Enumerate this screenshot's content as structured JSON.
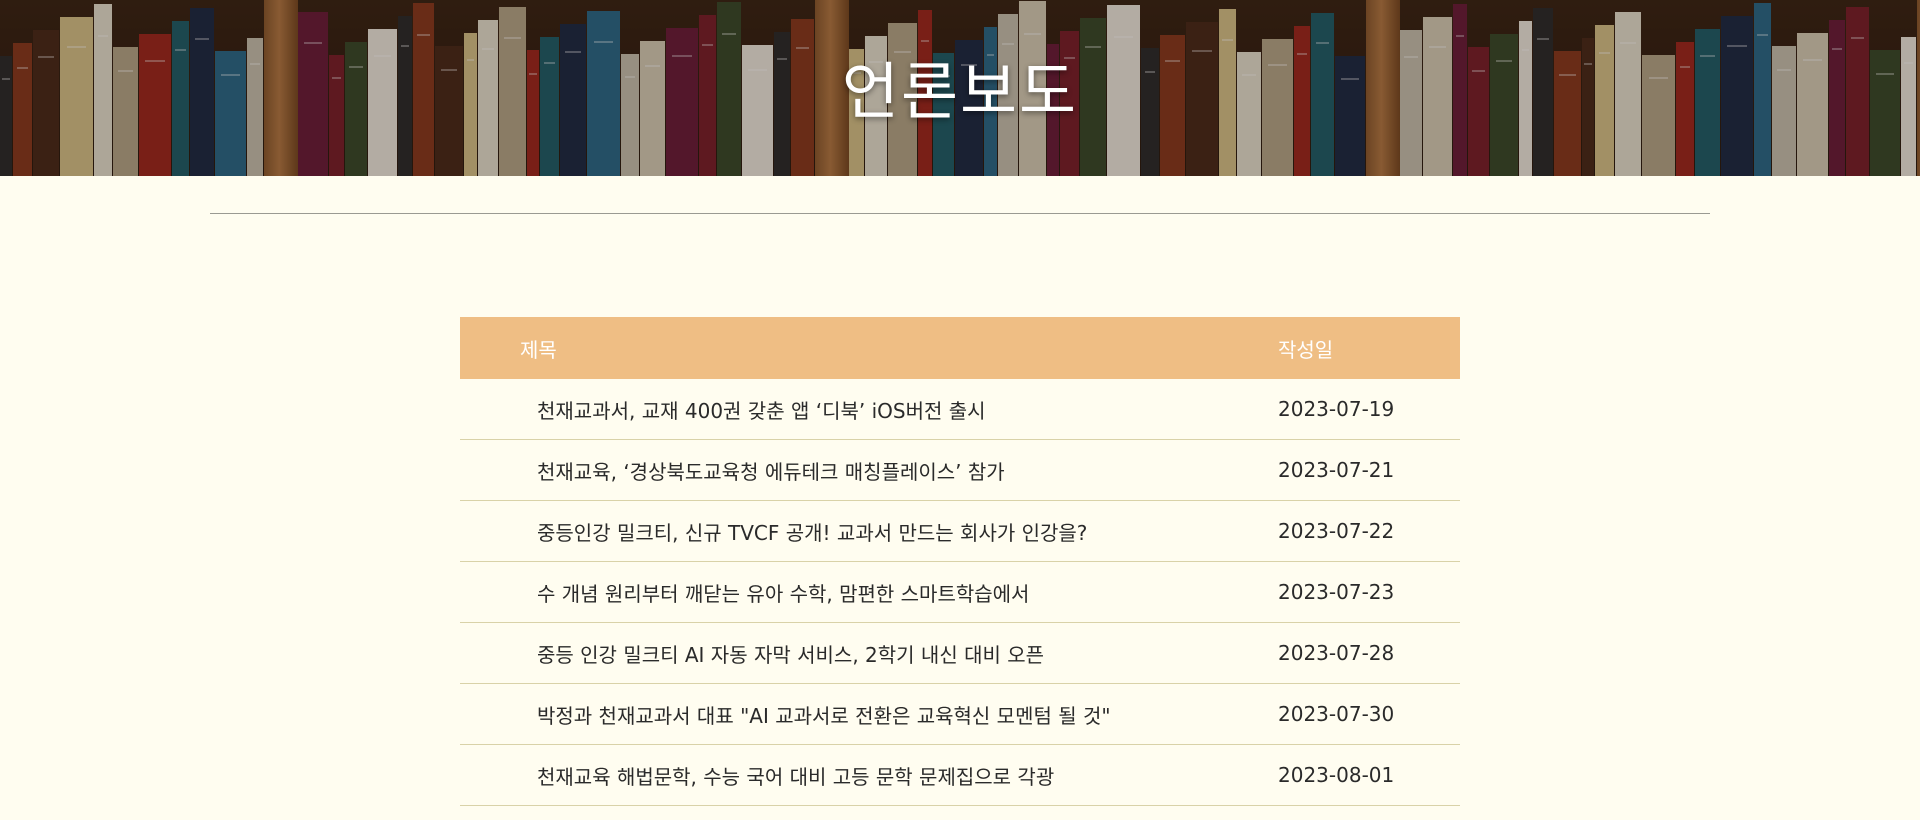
{
  "hero": {
    "title": "언론보도"
  },
  "board": {
    "columns": {
      "title": "제목",
      "date": "작성일"
    },
    "rows": [
      {
        "title": "천재교과서, 교재 400권 갖춘 앱 ‘디북’ iOS버전 출시",
        "date": "2023-07-19"
      },
      {
        "title": "천재교육, ‘경상북도교육청 에듀테크 매칭플레이스’ 참가",
        "date": "2023-07-21"
      },
      {
        "title": "중등인강 밀크티, 신규 TVCF 공개! 교과서 만드는 회사가 인강을?",
        "date": "2023-07-22"
      },
      {
        "title": "수 개념 원리부터 깨닫는 유아 수학, 맘편한 스마트학습에서",
        "date": "2023-07-23"
      },
      {
        "title": "중등 인강 밀크티 AI 자동 자막 서비스, 2학기 내신 대비 오픈",
        "date": "2023-07-28"
      },
      {
        "title": "박정과 천재교과서 대표 \"AI 교과서로 전환은 교육혁신 모멘텀 될 것\"",
        "date": "2023-07-30"
      },
      {
        "title": "천재교육 해법문학, 수능 국어 대비 고등 문학 문제집으로 각광",
        "date": "2023-08-01"
      }
    ]
  },
  "colors": {
    "page_background": "#fffdf0",
    "header_bar": "#efbe84",
    "row_border": "#d9d2a8"
  }
}
